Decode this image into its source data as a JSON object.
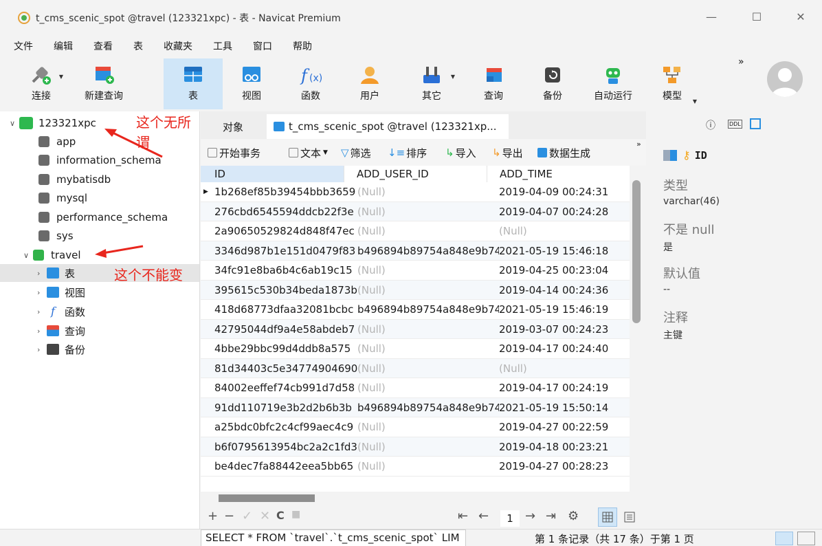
{
  "window": {
    "title": "t_cms_scenic_spot @travel (123321xpc) - 表 - Navicat Premium",
    "minimize": "—",
    "maximize": "☐",
    "close": "✕"
  },
  "menu": [
    "文件",
    "编辑",
    "查看",
    "表",
    "收藏夹",
    "工具",
    "窗口",
    "帮助"
  ],
  "toolbar": {
    "connect": "连接",
    "new_query": "新建查询",
    "table": "表",
    "view": "视图",
    "function": "函数",
    "user": "用户",
    "other": "其它",
    "query": "查询",
    "backup": "备份",
    "auto_run": "自动运行",
    "model": "模型",
    "more": "»"
  },
  "sidebar": {
    "connection": "123321xpc",
    "databases": [
      "app",
      "information_schema",
      "mybatisdb",
      "mysql",
      "performance_schema",
      "sys"
    ],
    "active_db": "travel",
    "children": [
      "表",
      "视图",
      "函数",
      "查询",
      "备份"
    ],
    "annotation_1": "这个无所谓",
    "annotation_2": "这个不能变"
  },
  "tabs": {
    "objects": "对象",
    "active": "t_cms_scenic_spot @travel (123321xp..."
  },
  "editor_toolbar": {
    "begin_transaction": "开始事务",
    "text": "文本",
    "filter": "筛选",
    "sort": "排序",
    "import": "导入",
    "export": "导出",
    "data_gen": "数据生成",
    "more": "»"
  },
  "grid": {
    "columns": [
      "ID",
      "ADD_USER_ID",
      "ADD_TIME"
    ],
    "rows": [
      {
        "id": "1b268ef85b39454bbb3659",
        "user": "(Null)",
        "time": "2019-04-09 00:24:31"
      },
      {
        "id": "276cbd6545594ddcb22f3e",
        "user": "(Null)",
        "time": "2019-04-07 00:24:28"
      },
      {
        "id": "2a90650529824d848f47ec",
        "user": "(Null)",
        "time": "(Null)"
      },
      {
        "id": "3346d987b1e151d0479f83",
        "user": "b496894b89754a848e9b74",
        "time": "2021-05-19 15:46:18"
      },
      {
        "id": "34fc91e8ba6b4c6ab19c15",
        "user": "(Null)",
        "time": "2019-04-25 00:23:04"
      },
      {
        "id": "395615c530b34beda1873b",
        "user": "(Null)",
        "time": "2019-04-14 00:24:36"
      },
      {
        "id": "418d68773dfaa32081bcbc",
        "user": "b496894b89754a848e9b74",
        "time": "2021-05-19 15:46:19"
      },
      {
        "id": "42795044df9a4e58abdeb7",
        "user": "(Null)",
        "time": "2019-03-07 00:24:23"
      },
      {
        "id": "4bbe29bbc99d4ddb8a575",
        "user": "(Null)",
        "time": "2019-04-17 00:24:40"
      },
      {
        "id": "81d34403c5e34774904690",
        "user": "(Null)",
        "time": "(Null)"
      },
      {
        "id": "84002eeffef74cb991d7d58",
        "user": "(Null)",
        "time": "2019-04-17 00:24:19"
      },
      {
        "id": "91dd110719e3b2d2b6b3b",
        "user": "b496894b89754a848e9b74",
        "time": "2021-05-19 15:50:14"
      },
      {
        "id": "a25bdc0bfc2c4cf99aec4c9",
        "user": "(Null)",
        "time": "2019-04-27 00:22:59"
      },
      {
        "id": "b6f0795613954bc2a2c1fd3",
        "user": "(Null)",
        "time": "2019-04-18 00:23:21"
      },
      {
        "id": "be4dec7fa88442eea5bb65",
        "user": "(Null)",
        "time": "2019-04-27 00:28:23"
      }
    ]
  },
  "grid_footer": {
    "add": "+",
    "remove": "−",
    "apply": "✓",
    "cancel": "✕",
    "refresh": "C",
    "stop": "■",
    "first": "⇤",
    "prev": "←",
    "page": "1",
    "next": "→",
    "last": "⇥",
    "settings": "⚙"
  },
  "properties": {
    "field_name": "ID",
    "type_label": "类型",
    "type_value": "varchar(46)",
    "notnull_label": "不是 null",
    "notnull_value": "是",
    "default_label": "默认值",
    "default_value": "--",
    "comment_label": "注释",
    "comment_value": "主键"
  },
  "status": {
    "query": "SELECT * FROM `travel`.`t_cms_scenic_spot` LIM",
    "record_info": "第 1 条记录（共 17 条）于第 1 页"
  }
}
